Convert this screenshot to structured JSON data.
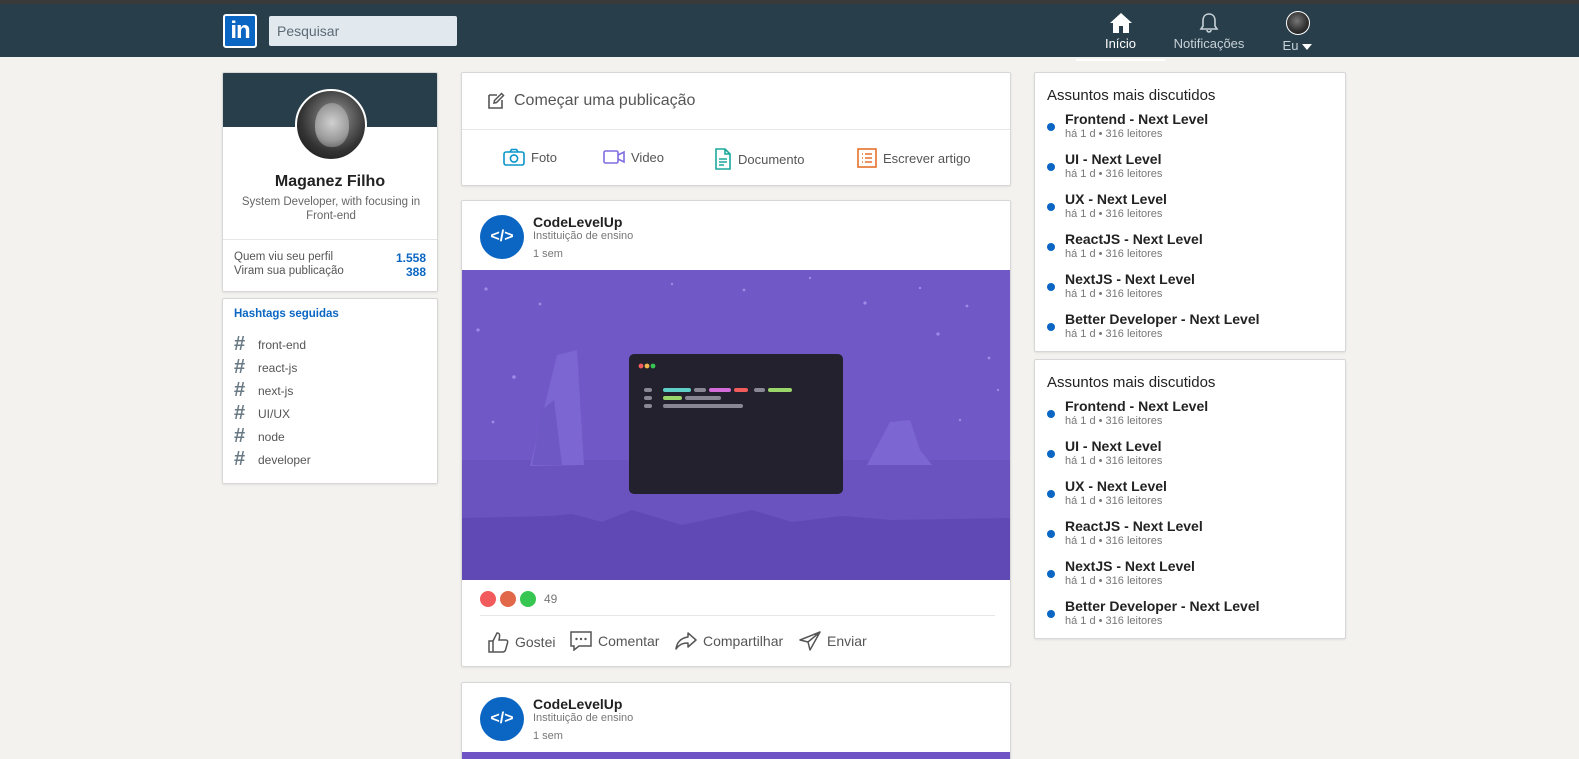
{
  "header": {
    "logo_text": "in",
    "search_placeholder": "Pesquisar",
    "nav": {
      "home": "Início",
      "notifications": "Notificações",
      "me": "Eu"
    }
  },
  "profile": {
    "name": "Maganez Filho",
    "description": "System Developer, with focusing in Front-end",
    "stats": [
      {
        "label": "Quem viu seu perfil",
        "value": "1.558"
      },
      {
        "label": "Viram sua publicação",
        "value": "388"
      }
    ]
  },
  "hashtags": {
    "title": "Hashtags seguidas",
    "symbol": "#",
    "items": [
      "front-end",
      "react-js",
      "next-js",
      "UI/UX",
      "node",
      "developer"
    ]
  },
  "start_post": {
    "prompt": "Começar uma publicação",
    "actions": [
      {
        "label": "Foto",
        "icon": "camera-icon",
        "color": "#0a95c9"
      },
      {
        "label": "Video",
        "icon": "video-icon",
        "color": "#7f6de0"
      },
      {
        "label": "Documento",
        "icon": "document-icon",
        "color": "#1ba89c"
      },
      {
        "label": "Escrever artigo",
        "icon": "article-icon",
        "color": "#e5722b"
      }
    ]
  },
  "posts": [
    {
      "author": "CodeLevelUp",
      "subtitle": "Instituição de ensino",
      "time": "1 sem",
      "avatar_glyph": "</>",
      "reaction_count": "49",
      "reaction_colors": [
        "#f25b5b",
        "#e2684a",
        "#37c651"
      ],
      "actions": [
        "Gostei",
        "Comentar",
        "Compartilhar",
        "Enviar"
      ]
    },
    {
      "author": "CodeLevelUp",
      "subtitle": "Instituição de ensino",
      "time": "1 sem",
      "avatar_glyph": "</>"
    }
  ],
  "trends": [
    {
      "title": "Assuntos mais discutidos",
      "items": [
        {
          "name": "Frontend - Next Level",
          "meta": "há 1 d • 316 leitores"
        },
        {
          "name": "UI - Next Level",
          "meta": "há 1 d • 316 leitores"
        },
        {
          "name": "UX - Next Level",
          "meta": "há 1 d • 316 leitores"
        },
        {
          "name": "ReactJS - Next Level",
          "meta": "há 1 d • 316 leitores"
        },
        {
          "name": "NextJS - Next Level",
          "meta": "há 1 d • 316 leitores"
        },
        {
          "name": "Better Developer - Next Level",
          "meta": "há 1 d • 316 leitores"
        }
      ]
    },
    {
      "title": "Assuntos mais discutidos",
      "items": [
        {
          "name": "Frontend - Next Level",
          "meta": "há 1 d • 316 leitores"
        },
        {
          "name": "UI - Next Level",
          "meta": "há 1 d • 316 leitores"
        },
        {
          "name": "UX - Next Level",
          "meta": "há 1 d • 316 leitores"
        },
        {
          "name": "ReactJS - Next Level",
          "meta": "há 1 d • 316 leitores"
        },
        {
          "name": "NextJS - Next Level",
          "meta": "há 1 d • 316 leitores"
        },
        {
          "name": "Better Developer - Next Level",
          "meta": "há 1 d • 316 leitores"
        }
      ]
    }
  ],
  "colors": {
    "header_bg": "#283e4a",
    "accent": "#0a66c2",
    "page_bg": "#f3f2ef",
    "post_image_bg": "#6f54c6"
  }
}
